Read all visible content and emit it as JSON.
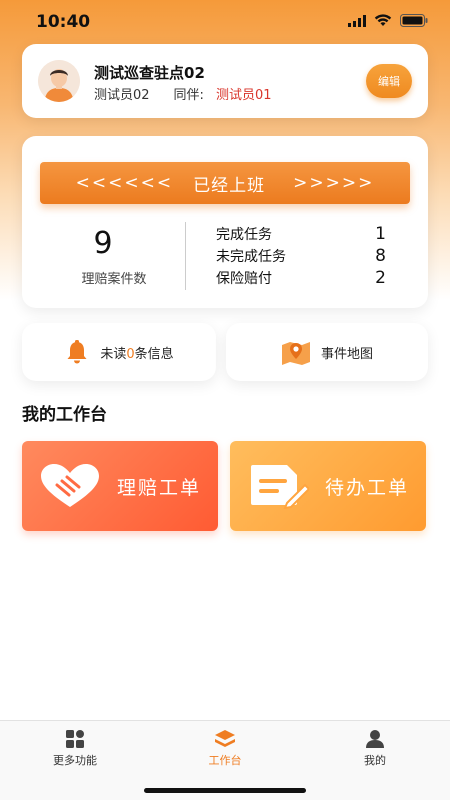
{
  "status_bar": {
    "time": "10:40"
  },
  "profile": {
    "station_name": "测试巡查驻点02",
    "user_name": "测试员02",
    "partner_label": "同伴:",
    "partner_name": "测试员01",
    "edit_label": "编辑"
  },
  "stats": {
    "shift_arrows_left": "<<<<<<",
    "shift_status": "已经上班",
    "shift_arrows_right": ">>>>>",
    "case_count": "9",
    "case_label": "理赔案件数",
    "tasks": [
      {
        "label": "完成任务",
        "value": "1"
      },
      {
        "label": "未完成任务",
        "value": "8"
      },
      {
        "label": "保险赔付",
        "value": "2"
      }
    ]
  },
  "quick": {
    "unread_prefix": "未读",
    "unread_count": "0",
    "unread_suffix": "条信息",
    "event_map_label": "事件地图"
  },
  "workbench": {
    "title": "我的工作台",
    "claim_label": "理赔工单",
    "todo_label": "待办工单"
  },
  "tabbar": {
    "items": [
      {
        "label": "更多功能",
        "icon": "grid-icon"
      },
      {
        "label": "工作台",
        "icon": "layers-icon",
        "active": true
      },
      {
        "label": "我的",
        "icon": "person-icon"
      }
    ]
  },
  "colors": {
    "accent": "#ef7d22",
    "partner": "#d9352b",
    "claim": "#ff5b33",
    "todo": "#ff9b30"
  }
}
